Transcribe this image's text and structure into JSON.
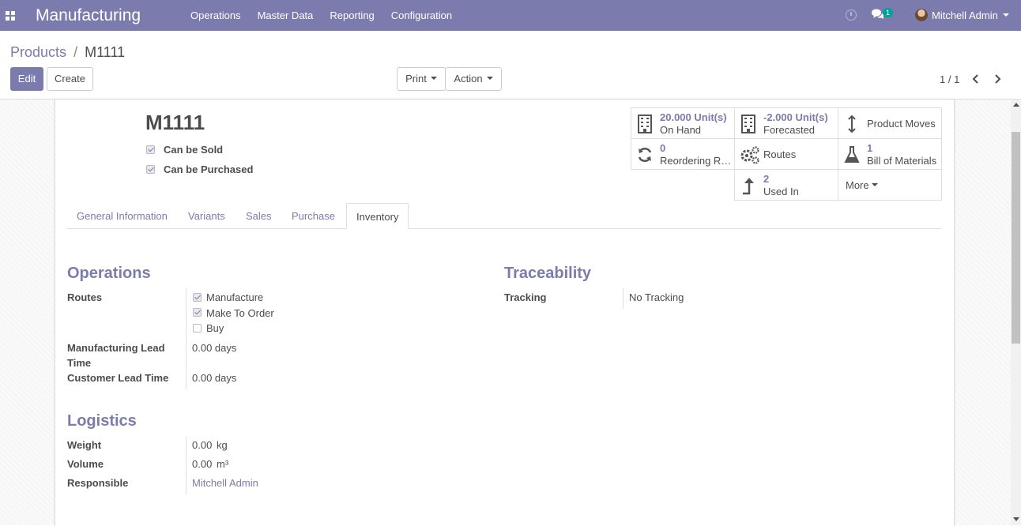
{
  "navbar": {
    "app_name": "Manufacturing",
    "menus": [
      "Operations",
      "Master Data",
      "Reporting",
      "Configuration"
    ],
    "chat_count": "1",
    "user_name": "Mitchell Admin",
    "bg_color": "#7c7bad"
  },
  "breadcrumb": {
    "parent": "Products",
    "separator": "/",
    "current": "M1111"
  },
  "buttons": {
    "edit": "Edit",
    "create": "Create",
    "print": "Print",
    "action": "Action"
  },
  "pager": {
    "value": "1 / 1"
  },
  "product": {
    "name": "M1111",
    "can_be_sold": "Can be Sold",
    "can_be_purchased": "Can be Purchased"
  },
  "smart_buttons": {
    "on_hand_value": "20.000",
    "on_hand_unit": "Unit(s)",
    "on_hand_label": "On Hand",
    "forecasted_value": "-2.000",
    "forecasted_unit": "Unit(s)",
    "forecasted_label": "Forecasted",
    "product_moves": "Product Moves",
    "reordering_count": "0",
    "reordering_label": "Reordering R…",
    "routes": "Routes",
    "bom_count": "1",
    "bom_label": "Bill of Materials",
    "used_in_count": "2",
    "used_in_label": "Used In",
    "more": "More"
  },
  "tabs": [
    "General Information",
    "Variants",
    "Sales",
    "Purchase",
    "Inventory"
  ],
  "operations": {
    "title": "Operations",
    "routes_label": "Routes",
    "routes": [
      {
        "label": "Manufacture",
        "checked": true
      },
      {
        "label": "Make To Order",
        "checked": true
      },
      {
        "label": "Buy",
        "checked": false
      }
    ],
    "mfg_lead_label_1": "Manufacturing Lead",
    "mfg_lead_label_2": "Time",
    "mfg_lead_value": "0.00 days",
    "customer_lead_label": "Customer Lead Time",
    "customer_lead_value": "0.00 days"
  },
  "traceability": {
    "title": "Traceability",
    "tracking_label": "Tracking",
    "tracking_value": "No Tracking"
  },
  "logistics": {
    "title": "Logistics",
    "weight_label": "Weight",
    "weight_value": "0.00",
    "weight_unit": "kg",
    "volume_label": "Volume",
    "volume_value": "0.00",
    "volume_unit": "m³",
    "responsible_label": "Responsible",
    "responsible_value": "Mitchell Admin"
  }
}
